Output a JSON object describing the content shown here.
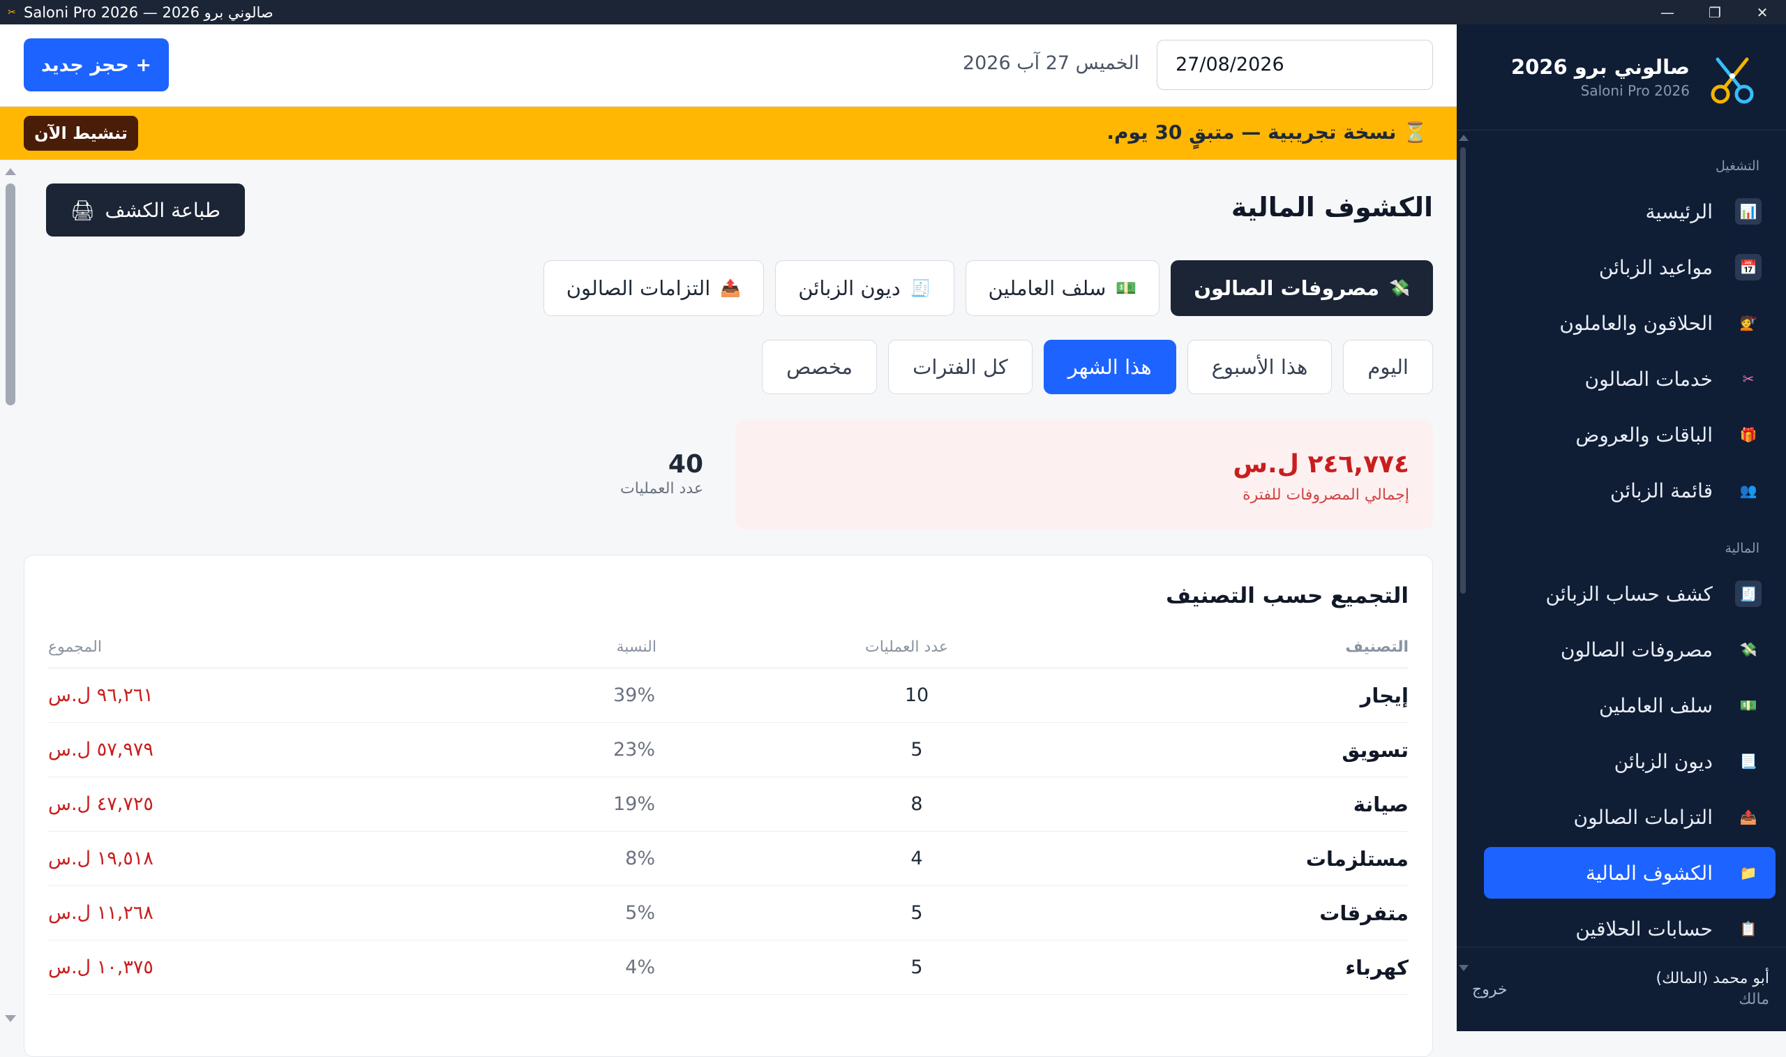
{
  "window": {
    "title": "Saloni Pro 2026 — صالوني برو 2026",
    "controls": [
      "minimize-icon",
      "restore-icon",
      "close-icon"
    ]
  },
  "topbar": {
    "date_value": "27/08/2026",
    "date_label": "الخميس 27 آب 2026",
    "new_booking": "+ حجز جديد"
  },
  "trial": {
    "message": "⏳ نسخة تجريبية — متبقٍ 30 يوم.",
    "activate": "تنشيط الآن"
  },
  "page": {
    "title": "الكشوف المالية",
    "print": "طباعة الكشف"
  },
  "tabs": [
    {
      "label": "مصروفات الصالون",
      "icon": "💸"
    },
    {
      "label": "سلف العاملين",
      "icon": "💵"
    },
    {
      "label": "ديون الزبائن",
      "icon": "🧾"
    },
    {
      "label": "التزامات الصالون",
      "icon": "📤"
    }
  ],
  "periods": [
    "اليوم",
    "هذا الأسبوع",
    "هذا الشهر",
    "كل الفترات",
    "مخصص"
  ],
  "summary": {
    "total_amount": "٢٤٦,٧٧٤ ل.س",
    "total_label": "إجمالي المصروفات للفترة",
    "count_value": "40",
    "count_label": "عدد العمليات"
  },
  "breakdown": {
    "title": "التجميع حسب التصنيف",
    "headers": {
      "category": "التصنيف",
      "count": "عدد العمليات",
      "percent": "النسبة",
      "sum": "المجموع"
    },
    "rows": [
      {
        "category": "إيجار",
        "count": "10",
        "percent": "39%",
        "sum": "٩٦,٢٦١ ل.س"
      },
      {
        "category": "تسويق",
        "count": "5",
        "percent": "23%",
        "sum": "٥٧,٩٧٩ ل.س"
      },
      {
        "category": "صيانة",
        "count": "8",
        "percent": "19%",
        "sum": "٤٧,٧٢٥ ل.س"
      },
      {
        "category": "مستلزمات",
        "count": "4",
        "percent": "8%",
        "sum": "١٩,٥١٨ ل.س"
      },
      {
        "category": "متفرقات",
        "count": "5",
        "percent": "5%",
        "sum": "١١,٢٦٨ ل.س"
      },
      {
        "category": "كهرباء",
        "count": "5",
        "percent": "4%",
        "sum": "١٠,٣٧٥ ل.س"
      }
    ]
  },
  "sidebar": {
    "brand_name": "صالوني برو 2026",
    "brand_sub": "Saloni Pro 2026",
    "sections": {
      "operation": "التشغيل",
      "finance": "المالية"
    },
    "items": [
      {
        "label": "الرئيسية",
        "icon": "📊"
      },
      {
        "label": "مواعيد الزبائن",
        "icon": "📅"
      },
      {
        "label": "الحلاقون والعاملون",
        "icon": "💇"
      },
      {
        "label": "خدمات الصالون",
        "icon": "✂"
      },
      {
        "label": "الباقات والعروض",
        "icon": "🎁"
      },
      {
        "label": "قائمة الزبائن",
        "icon": "👥"
      },
      {
        "label": "كشف حساب الزبائن",
        "icon": "🧾"
      },
      {
        "label": "مصروفات الصالون",
        "icon": "💸"
      },
      {
        "label": "سلف العاملين",
        "icon": "💵"
      },
      {
        "label": "ديون الزبائن",
        "icon": "📃"
      },
      {
        "label": "التزامات الصالون",
        "icon": "📤"
      },
      {
        "label": "الكشوف المالية",
        "icon": "📁"
      },
      {
        "label": "حسابات الحلاقين",
        "icon": "📋"
      }
    ],
    "user_name": "أبو محمد (المالك)",
    "user_role": "مالك",
    "logout": "خروج"
  },
  "colors": {
    "accent": "#1d63ff",
    "sidebar_bg": "#0f1d35",
    "trial_banner": "#ffb703",
    "expense_red": "#c81e1e",
    "dark_button": "#1c2536"
  }
}
